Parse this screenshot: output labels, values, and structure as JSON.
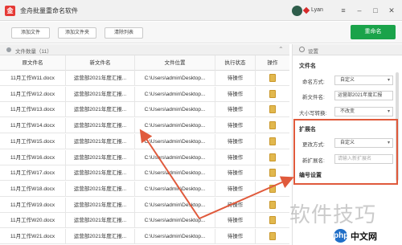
{
  "app": {
    "title": "金舟批量重命名软件",
    "icon_label": "金",
    "user": "Lyan"
  },
  "toolbar": {
    "add_file": "添加文件",
    "add_folder": "添加文件夹",
    "clear_list": "清除列表",
    "start": "重命名"
  },
  "file_list": {
    "header": "文件数量（11）",
    "columns": [
      "原文件名",
      "新文件名",
      "文件位置",
      "执行状态",
      "操作"
    ],
    "rows": [
      {
        "orig": "11月工作W11.docx",
        "new": "运营部2021年度汇报...",
        "path": "C:\\Users\\admin\\Desktop...",
        "status": "待操作"
      },
      {
        "orig": "11月工作W12.docx",
        "new": "运营部2021年度汇报...",
        "path": "C:\\Users\\admin\\Desktop...",
        "status": "待操作"
      },
      {
        "orig": "11月工作W13.docx",
        "new": "运营部2021年度汇报...",
        "path": "C:\\Users\\admin\\Desktop...",
        "status": "待操作"
      },
      {
        "orig": "11月工作W14.docx",
        "new": "运营部2021年度汇报...",
        "path": "C:\\Users\\admin\\Desktop...",
        "status": "待操作"
      },
      {
        "orig": "11月工作W15.docx",
        "new": "运营部2021年度汇报...",
        "path": "C:\\Users\\admin\\Desktop...",
        "status": "待操作"
      },
      {
        "orig": "11月工作W16.docx",
        "new": "运营部2021年度汇报...",
        "path": "C:\\Users\\admin\\Desktop...",
        "status": "待操作"
      },
      {
        "orig": "11月工作W17.docx",
        "new": "运营部2021年度汇报...",
        "path": "C:\\Users\\admin\\Desktop...",
        "status": "待操作"
      },
      {
        "orig": "11月工作W18.docx",
        "new": "运营部2021年度汇报...",
        "path": "C:\\Users\\admin\\Desktop...",
        "status": "待操作"
      },
      {
        "orig": "11月工作W19.docx",
        "new": "运营部2021年度汇报...",
        "path": "C:\\Users\\admin\\Desktop...",
        "status": "待操作"
      },
      {
        "orig": "11月工作W20.docx",
        "new": "运营部2021年度汇报...",
        "path": "C:\\Users\\admin\\Desktop...",
        "status": "待操作"
      },
      {
        "orig": "11月工作W21.docx",
        "new": "运营部2021年度汇报...",
        "path": "C:\\Users\\admin\\Desktop...",
        "status": "待操作"
      }
    ]
  },
  "settings": {
    "header": "设置",
    "file_name_section": "文件名",
    "naming_mode_label": "命名方式:",
    "naming_mode_value": "自定义",
    "new_name_label": "新文件名:",
    "new_name_value": "运营部2021年度汇报",
    "case_label": "大小写转换:",
    "case_value": "不改变",
    "ext_section": "扩展名",
    "ext_mode_label": "更改方式:",
    "ext_mode_value": "自定义",
    "new_ext_label": "新扩展名:",
    "new_ext_placeholder": "请输入新扩展名",
    "number_section": "编号设置"
  },
  "watermark": {
    "text": "软件技巧",
    "logo_text": "中文网",
    "logo_mark": "php"
  },
  "colors": {
    "accent_green": "#1aa34a",
    "annotation_red": "#e05a3c",
    "title_red": "#e53935"
  }
}
